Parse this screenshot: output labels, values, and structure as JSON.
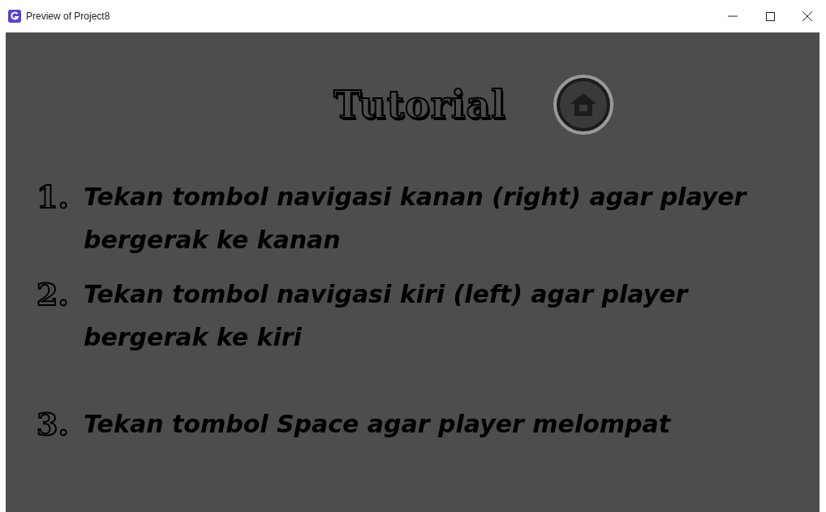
{
  "window": {
    "title": "Preview of Project8"
  },
  "screen": {
    "title": "Tutorial",
    "steps": [
      {
        "number": "1.",
        "text": "Tekan tombol navigasi kanan (right) agar player bergerak ke kanan"
      },
      {
        "number": "2.",
        "text": "Tekan tombol navigasi kiri (left) agar player bergerak ke kiri"
      },
      {
        "number": "3.",
        "text": "Tekan tombol Space agar player melompat"
      }
    ]
  }
}
